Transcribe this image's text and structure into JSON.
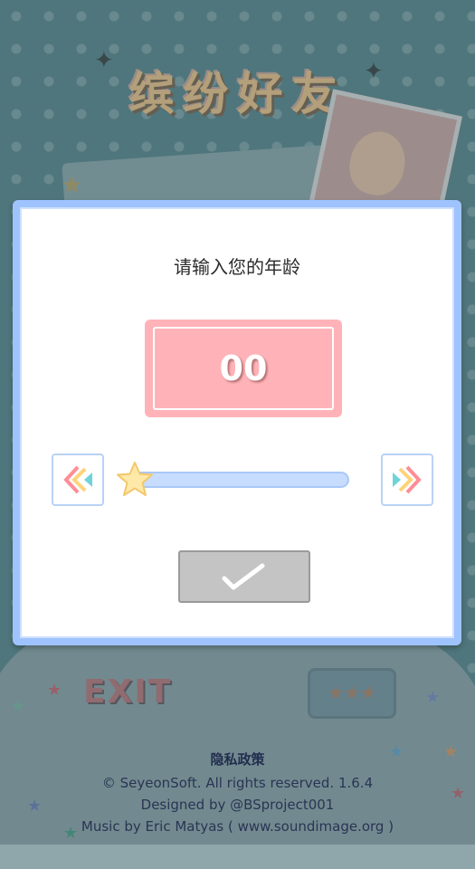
{
  "background": {
    "game_title": "缤纷好友",
    "exit_label": "EXIT"
  },
  "dialog": {
    "title": "请输入您的年龄",
    "age_value": "00",
    "slider_value": 0
  },
  "footer": {
    "privacy": "隐私政策",
    "copyright": "© SeyeonSoft. All rights reserved.   1.6.4",
    "designed": "Designed by @BSproject001",
    "music": "Music by Eric Matyas ( www.soundimage.org )"
  },
  "colors": {
    "dialog_border": "#9ec3ff",
    "age_box": "#ffb3b8",
    "confirm_button": "#c4c4c4"
  },
  "icons": {
    "decrease": "double-chevron-left-icon",
    "increase": "double-chevron-right-icon",
    "slider_thumb": "star-icon",
    "confirm": "checkmark-icon"
  }
}
